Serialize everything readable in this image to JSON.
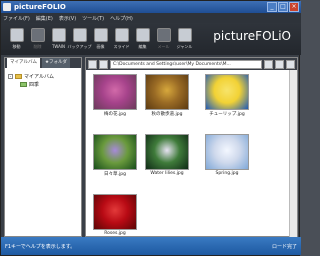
{
  "window": {
    "title": "pictureFOLIO"
  },
  "menu": [
    "ファイル(F)",
    "編集(E)",
    "表示(V)",
    "ツール(T)",
    "ヘルプ(H)"
  ],
  "toolbar": [
    {
      "label": "移動",
      "disabled": false
    },
    {
      "label": "削除",
      "disabled": true
    },
    {
      "label": "TWAIN",
      "disabled": false
    },
    {
      "label": "バックアップ",
      "disabled": false
    },
    {
      "label": "画像",
      "disabled": false
    },
    {
      "label": "スライド",
      "disabled": false
    },
    {
      "label": "編集",
      "disabled": false
    },
    {
      "label": "メール",
      "disabled": true
    },
    {
      "label": "ジャンル",
      "disabled": false
    }
  ],
  "brand": "pictureFOLiO",
  "left_tabs": [
    "マイアルバム",
    "★フォルダ"
  ],
  "tree": {
    "root": "マイアルバム",
    "child": "四季"
  },
  "path": "C:\\Documents and Settings\\user\\My Documents\\M...",
  "thumbnails": [
    {
      "name": "梅の花.jpg",
      "colors": [
        "#6b3a5a",
        "#a6438b",
        "#d26aa9"
      ]
    },
    {
      "name": "秋の散歩道.jpg",
      "colors": [
        "#5c3a12",
        "#9a6b25",
        "#d7a83c"
      ]
    },
    {
      "name": "チューリップ.jpg",
      "colors": [
        "#1f5ab8",
        "#f2d235",
        "#f7e46b"
      ]
    },
    {
      "name": "日々草.jpg",
      "colors": [
        "#174d1a",
        "#6a9a3d",
        "#a78ad9"
      ]
    },
    {
      "name": "Water lilies.jpg",
      "colors": [
        "#0f2a16",
        "#3f7b3a",
        "#e7e3f2"
      ]
    },
    {
      "name": "Spring.jpg",
      "colors": [
        "#7fa8d8",
        "#cfd9ec",
        "#f3f7ff"
      ]
    },
    {
      "name": "Roses.jpg",
      "colors": [
        "#5b0505",
        "#b80a14",
        "#e33a3a"
      ]
    }
  ],
  "status": {
    "left": "F1キーでヘルプを表示します。",
    "right": "ロード完了"
  }
}
